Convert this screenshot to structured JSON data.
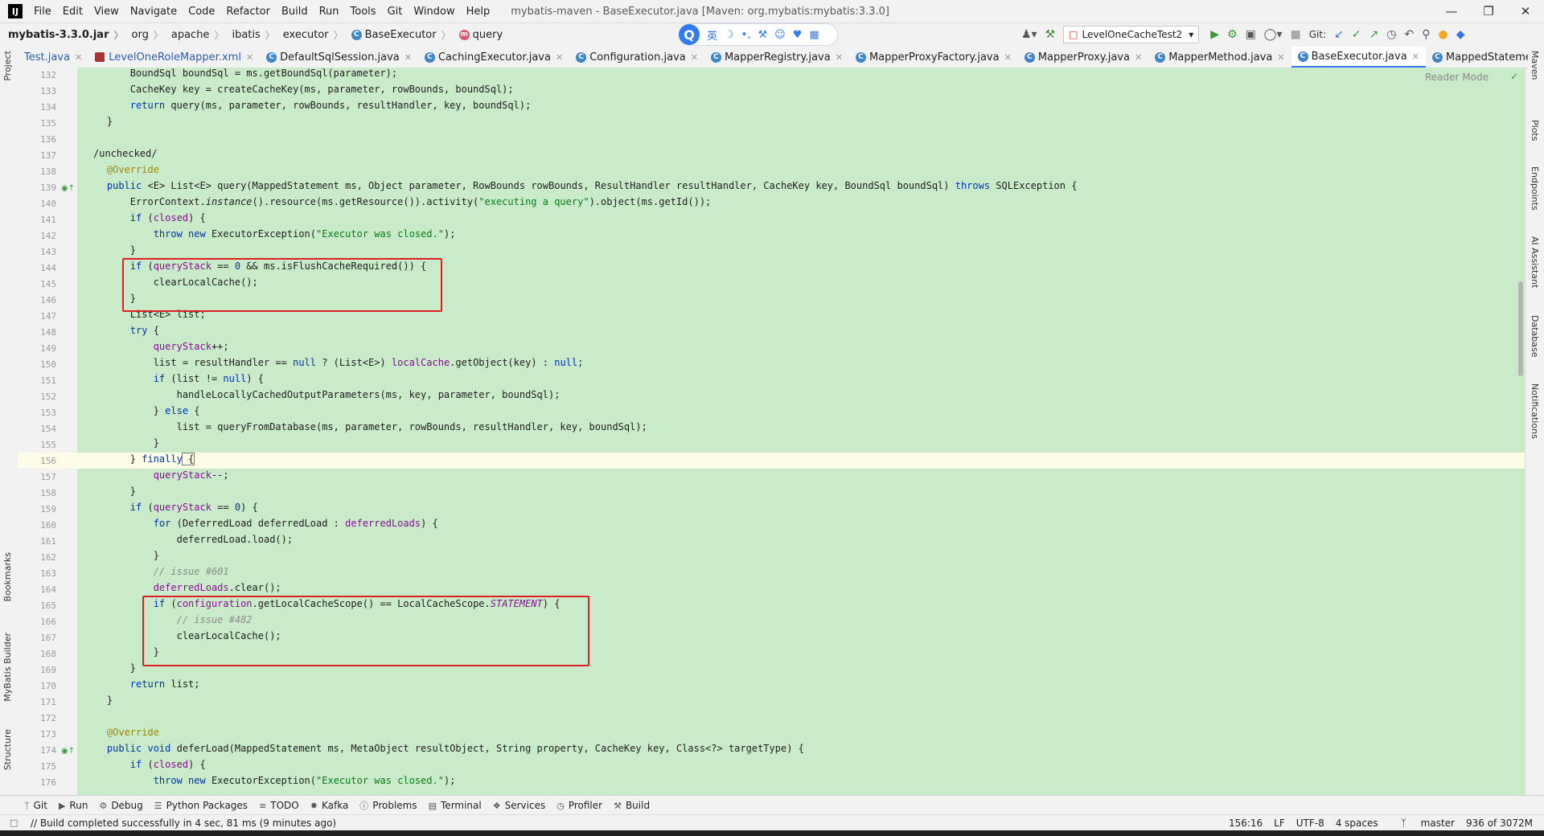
{
  "menubar": {
    "logo": "IJ",
    "items": [
      "File",
      "Edit",
      "View",
      "Navigate",
      "Code",
      "Refactor",
      "Build",
      "Run",
      "Tools",
      "Git",
      "Window",
      "Help"
    ],
    "window_title": "mybatis-maven - BaseExecutor.java [Maven: org.mybatis:mybatis:3.3.0]"
  },
  "breadcrumbs": {
    "jar": "mybatis-3.3.0.jar",
    "parts": [
      "org",
      "apache",
      "ibatis",
      "executor"
    ],
    "class_name": "BaseExecutor",
    "method_name": "query"
  },
  "ime": {
    "q": "Q",
    "lang": "英"
  },
  "toolbar": {
    "run_config": "LevelOneCacheTest2",
    "git_label": "Git:"
  },
  "tabs": [
    {
      "label": "Test.java",
      "type": "plain"
    },
    {
      "label": "LevelOneRoleMapper.xml",
      "type": "xml"
    },
    {
      "label": "DefaultSqlSession.java",
      "type": "class"
    },
    {
      "label": "CachingExecutor.java",
      "type": "class"
    },
    {
      "label": "Configuration.java",
      "type": "class"
    },
    {
      "label": "MapperRegistry.java",
      "type": "class"
    },
    {
      "label": "MapperProxyFactory.java",
      "type": "class"
    },
    {
      "label": "MapperProxy.java",
      "type": "class"
    },
    {
      "label": "MapperMethod.java",
      "type": "class"
    },
    {
      "label": "BaseExecutor.java",
      "type": "class",
      "active": true
    },
    {
      "label": "MappedStatement.java",
      "type": "class"
    }
  ],
  "left_tools": [
    "Project",
    "Bookmarks",
    "MyBatis Builder",
    "Structure"
  ],
  "right_tools": [
    "Maven",
    "Plots",
    "Endpoints",
    "AI Assistant",
    "Database",
    "Notifications"
  ],
  "editor": {
    "reader_mode": "Reader Mode",
    "line_numbers": [
      "132",
      "133",
      "134",
      "135",
      "136",
      "137",
      "138",
      "139",
      "140",
      "141",
      "142",
      "143",
      "144",
      "145",
      "146",
      "147",
      "148",
      "149",
      "150",
      "151",
      "152",
      "153",
      "154",
      "155",
      "156",
      "157",
      "158",
      "159",
      "160",
      "161",
      "162",
      "163",
      "164",
      "165",
      "166",
      "167",
      "168",
      "169",
      "170",
      "171",
      "172",
      "173",
      "174",
      "175",
      "176"
    ],
    "code": {
      "l132": "        BoundSql boundSql = ms.getBoundSql(parameter);",
      "l133": "        CacheKey key = createCacheKey(ms, parameter, rowBounds, boundSql);",
      "l134a": "        ",
      "l134b": "return",
      "l134c": " query(ms, parameter, rowBounds, resultHandler, key, boundSql);",
      "l135": "    }",
      "l137": "/unchecked/",
      "l138": "    @Override",
      "l139a": "    ",
      "l139b": "public",
      "l139c": " <E> List<E> query(MappedStatement ms, Object parameter, RowBounds rowBounds, ResultHandler resultHandler, CacheKey key, BoundSql boundSql) ",
      "l139d": "throws",
      "l139e": " SQLException {",
      "l140a": "        ErrorContext.",
      "l140b": "instance",
      "l140c": "().resource(ms.getResource()).activity(",
      "l140d": "\"executing a query\"",
      "l140e": ").object(ms.getId());",
      "l141a": "        ",
      "l141b": "if",
      "l141c": " (",
      "l141d": "closed",
      "l141e": ") {",
      "l142a": "            ",
      "l142b": "throw new",
      "l142c": " ExecutorException(",
      "l142d": "\"Executor was closed.\"",
      "l142e": ");",
      "l143": "        }",
      "l144a": "        ",
      "l144b": "if",
      "l144c": " (",
      "l144d": "queryStack",
      "l144e": " == ",
      "l144f": "0",
      "l144g": " && ms.isFlushCacheRequired()) {",
      "l145": "            clearLocalCache();",
      "l146": "        }",
      "l147": "        List<E> list;",
      "l148a": "        ",
      "l148b": "try",
      "l148c": " {",
      "l149a": "            ",
      "l149b": "queryStack",
      "l149c": "++;",
      "l150a": "            list = resultHandler == ",
      "l150b": "null",
      "l150c": " ? (List<E>) ",
      "l150d": "localCache",
      "l150e": ".getObject(key) : ",
      "l150f": "null",
      "l150g": ";",
      "l151a": "            ",
      "l151b": "if",
      "l151c": " (list != ",
      "l151d": "null",
      "l151e": ") {",
      "l152": "                handleLocallyCachedOutputParameters(ms, key, parameter, boundSql);",
      "l153a": "            } ",
      "l153b": "else",
      "l153c": " {",
      "l154": "                list = queryFromDatabase(ms, parameter, rowBounds, resultHandler, key, boundSql);",
      "l155": "            }",
      "l156a": "        } ",
      "l156b": "finally",
      "l156c": " {",
      "l157a": "            ",
      "l157b": "queryStack",
      "l157c": "--;",
      "l158": "        }",
      "l159a": "        ",
      "l159b": "if",
      "l159c": " (",
      "l159d": "queryStack",
      "l159e": " == ",
      "l159f": "0",
      "l159g": ") {",
      "l160a": "            ",
      "l160b": "for",
      "l160c": " (DeferredLoad deferredLoad : ",
      "l160d": "deferredLoads",
      "l160e": ") {",
      "l161": "                deferredLoad.load();",
      "l162": "            }",
      "l163": "            // issue #601",
      "l164a": "            ",
      "l164b": "deferredLoads",
      "l164c": ".clear();",
      "l165a": "            ",
      "l165b": "if",
      "l165c": " (",
      "l165d": "configuration",
      "l165e": ".getLocalCacheScope() == LocalCacheScope.",
      "l165f": "STATEMENT",
      "l165g": ") {",
      "l166": "                // issue #482",
      "l167": "                clearLocalCache();",
      "l168": "            }",
      "l169": "        }",
      "l170a": "        ",
      "l170b": "return",
      "l170c": " list;",
      "l171": "    }",
      "l173": "    @Override",
      "l174a": "    ",
      "l174b": "public void",
      "l174c": " deferLoad(MappedStatement ms, MetaObject resultObject, String property, CacheKey key, Class<?> targetType) {",
      "l175a": "        ",
      "l175b": "if",
      "l175c": " (",
      "l175d": "closed",
      "l175e": ") {",
      "l176a": "            ",
      "l176b": "throw new",
      "l176c": " ExecutorException(",
      "l176d": "\"Executor was closed.\"",
      "l176e": ");"
    }
  },
  "bottom_tools": [
    "Git",
    "Run",
    "Debug",
    "Python Packages",
    "TODO",
    "Kafka",
    "Problems",
    "Terminal",
    "Services",
    "Profiler",
    "Build"
  ],
  "status": {
    "message": "// Build completed successfully in 4 sec, 81 ms (9 minutes ago)",
    "position": "156:16",
    "line_sep": "LF",
    "encoding": "UTF-8",
    "indent": "4 spaces",
    "branch": "master",
    "memory": "936 of 3072M"
  },
  "colors": {
    "editor_bg": "#c9ebc9",
    "keyword": "#0033b3",
    "string": "#067d17",
    "field": "#871094",
    "annotation": "#9e880d",
    "highlight_box": "#e02020"
  }
}
